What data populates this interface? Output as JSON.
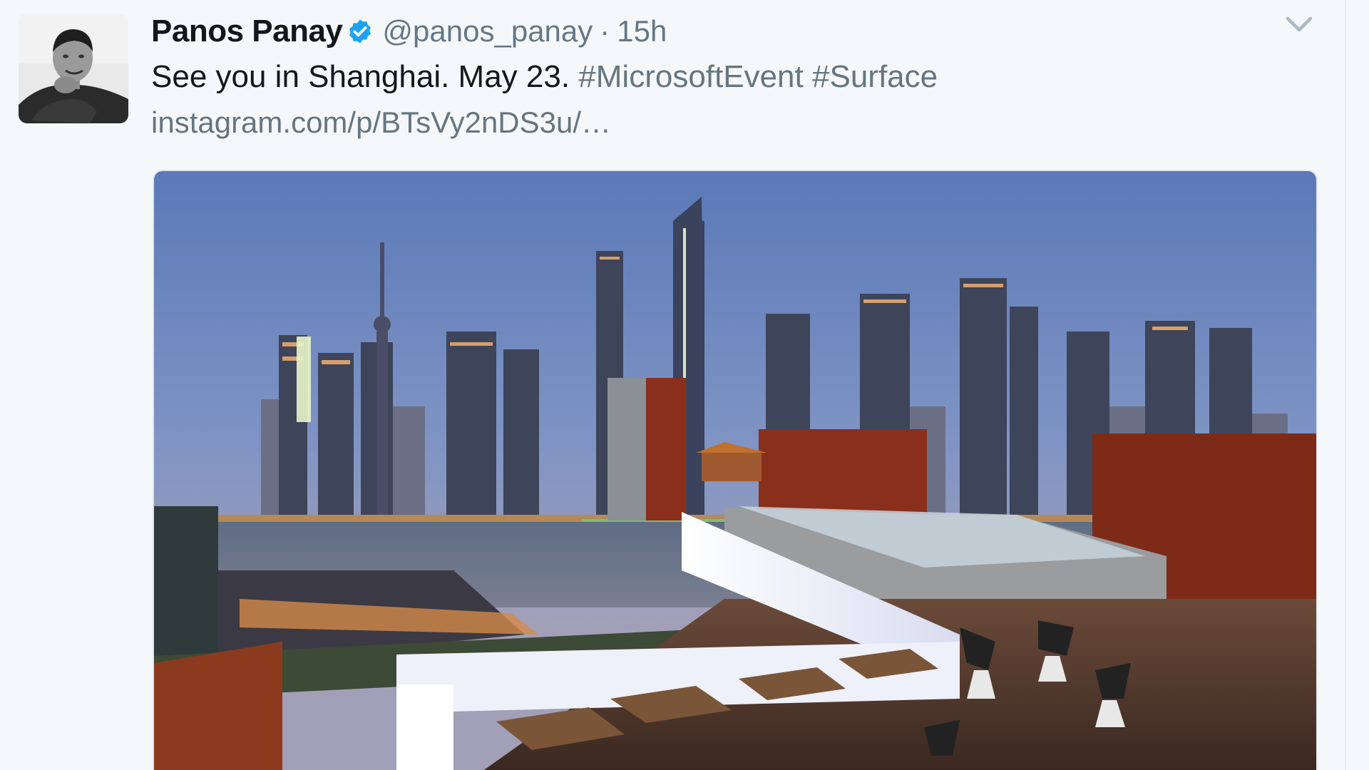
{
  "tweet": {
    "author": {
      "display_name": "Panos Panay",
      "handle": "@panos_panay",
      "verified": true,
      "avatar_icon": "avatar-photo"
    },
    "separator": "·",
    "time": "15h",
    "text_plain": "See you in Shanghai. May 23.",
    "hashtags": [
      "#MicrosoftEvent",
      "#Surface"
    ],
    "link": "instagram.com/p/BTsVy2nDS3u/…",
    "menu_icon": "chevron-down-icon",
    "media": {
      "type": "photo",
      "icon": "image-shanghai-rooftop"
    }
  },
  "colors": {
    "background": "#f5f8fa",
    "name": "#14171a",
    "secondary": "#657786",
    "verified": "#1da1f2",
    "border": "#e1e8ed"
  }
}
